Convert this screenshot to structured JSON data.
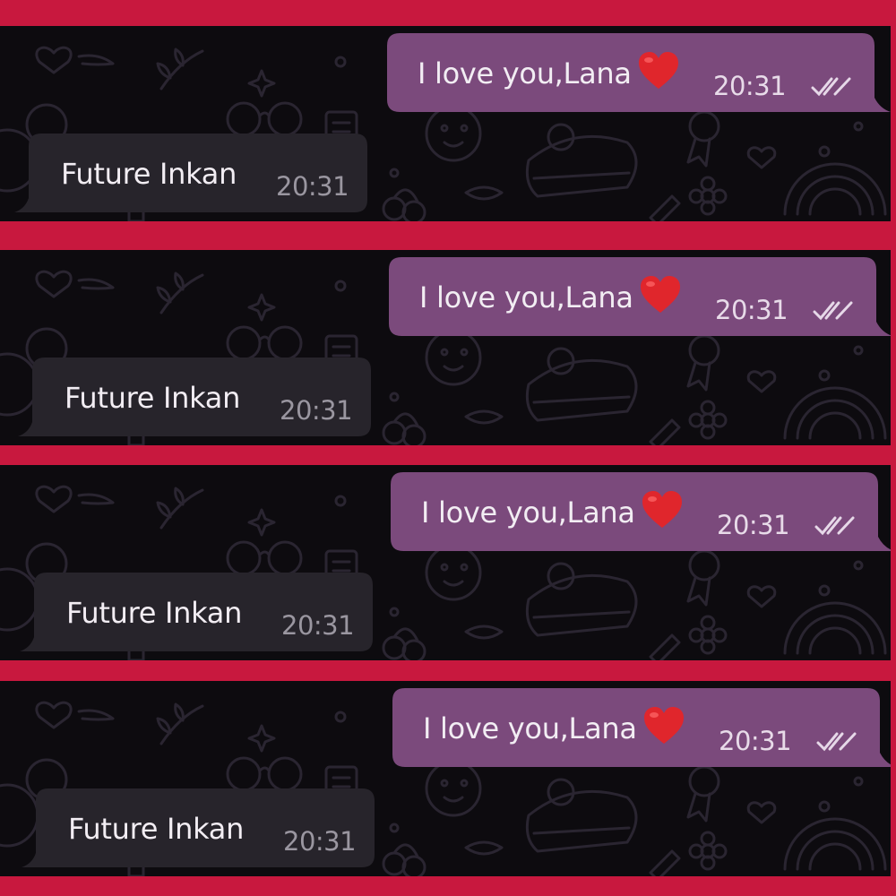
{
  "panels": [
    {
      "outgoing": {
        "text": "I love you,Lana",
        "emoji": "heart-emoji",
        "time": "20:31",
        "status_icon": "double-check-icon"
      },
      "incoming": {
        "text": "Future Inkan",
        "time": "20:31"
      }
    },
    {
      "outgoing": {
        "text": "I love you,Lana",
        "emoji": "heart-emoji",
        "time": "20:31",
        "status_icon": "double-check-icon"
      },
      "incoming": {
        "text": "Future Inkan",
        "time": "20:31"
      }
    },
    {
      "outgoing": {
        "text": "I love you,Lana",
        "emoji": "heart-emoji",
        "time": "20:31",
        "status_icon": "double-check-icon"
      },
      "incoming": {
        "text": "Future Inkan",
        "time": "20:31"
      }
    },
    {
      "outgoing": {
        "text": "I love you,Lana",
        "emoji": "heart-emoji",
        "time": "20:31",
        "status_icon": "double-check-icon"
      },
      "incoming": {
        "text": "Future Inkan",
        "time": "20:31"
      }
    }
  ],
  "colors": {
    "frame": "#c8183e",
    "chat_background": "#0d0b0f",
    "pattern": "#2a2531",
    "outgoing_bubble": "#7b4a7c",
    "incoming_bubble": "#27242b",
    "heart": "#e0262c"
  }
}
